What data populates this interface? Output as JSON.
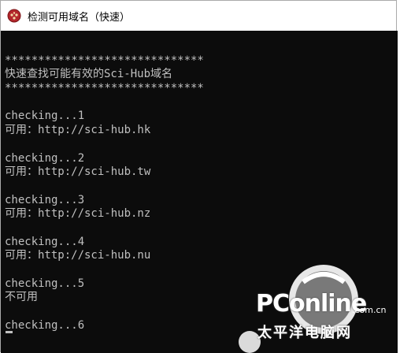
{
  "window": {
    "title": "检测可用域名（快速）",
    "icon": "app-icon",
    "colors": {
      "console_bg": "#0c0c0c",
      "console_text": "#c0c0c0",
      "titlebar_bg": "#ffffff"
    }
  },
  "console": {
    "lines": [
      "",
      "******************************",
      "快速查找可能有效的Sci-Hub域名",
      "******************************",
      "",
      "checking...1",
      "可用：http://sci-hub.hk",
      "",
      "checking...2",
      "可用：http://sci-hub.tw",
      "",
      "checking...3",
      "可用：http://sci-hub.nz",
      "",
      "checking...4",
      "可用：http://sci-hub.nu",
      "",
      "checking...5",
      "不可用",
      "",
      "checking...6"
    ]
  },
  "watermark": {
    "brand": "PConline",
    "domain": ".com.cn",
    "chinese": "太平洋电脑网"
  }
}
